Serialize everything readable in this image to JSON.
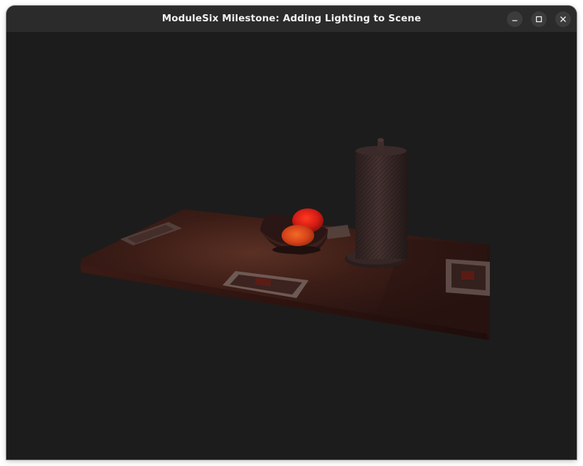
{
  "window": {
    "title": "ModuleSix Milestone: Adding Lighting to Scene",
    "controls": {
      "minimize_icon": "minimize-icon",
      "maximize_icon": "maximize-icon",
      "close_icon": "close-icon"
    }
  },
  "scene": {
    "background_color": "#1c1c1c",
    "table_color": "#3a1d17",
    "fruit_color": "#e0241a",
    "objects": [
      "table",
      "bowl",
      "fruit",
      "fruit",
      "paper-towel-holder",
      "playing-card",
      "playing-card",
      "playing-card",
      "playing-card"
    ]
  }
}
